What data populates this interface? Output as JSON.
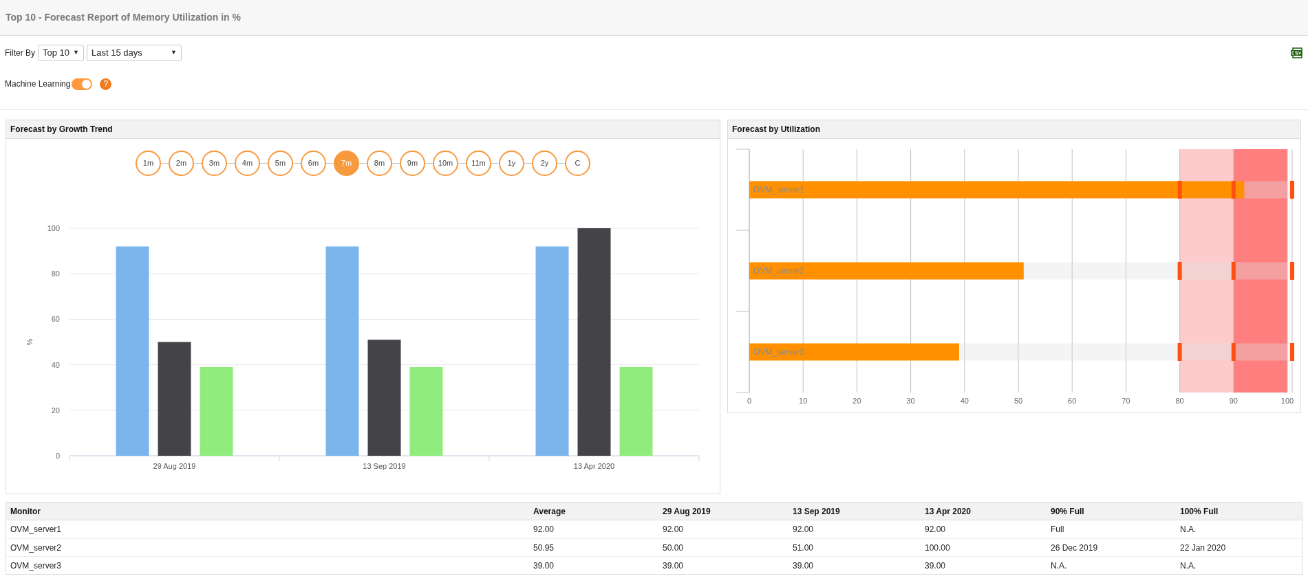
{
  "title": "Top 10 - Forecast Report of Memory Utilization in %",
  "filter": {
    "label": "Filter By",
    "selects": [
      {
        "value": "Top 10",
        "caret": "▼"
      },
      {
        "value": "Last 15 days",
        "caret": "▼"
      }
    ]
  },
  "machine_learning": {
    "label": "Machine Learning",
    "on": true,
    "help": "?"
  },
  "growth_panel": {
    "title": "Forecast by Growth Trend",
    "periods": [
      {
        "label": "1m",
        "selected": false
      },
      {
        "label": "2m",
        "selected": false
      },
      {
        "label": "3m",
        "selected": false
      },
      {
        "label": "4m",
        "selected": false
      },
      {
        "label": "5m",
        "selected": false
      },
      {
        "label": "6m",
        "selected": false
      },
      {
        "label": "7m",
        "selected": true
      },
      {
        "label": "8m",
        "selected": false
      },
      {
        "label": "9m",
        "selected": false
      },
      {
        "label": "10m",
        "selected": false
      },
      {
        "label": "11m",
        "selected": false
      },
      {
        "label": "1y",
        "selected": false
      },
      {
        "label": "2y",
        "selected": false
      },
      {
        "label": "C",
        "selected": false
      }
    ],
    "chart_data": {
      "type": "bar",
      "ylabel": "%",
      "categories": [
        "29 Aug 2019",
        "13 Sep 2019",
        "13 Apr 2020"
      ],
      "series": [
        {
          "color": "#7cb5ec",
          "values": [
            92,
            92,
            92
          ]
        },
        {
          "color": "#434348",
          "values": [
            50,
            51,
            100
          ]
        },
        {
          "color": "#90ed7d",
          "values": [
            39,
            39,
            39
          ]
        }
      ],
      "ylim": [
        0,
        100
      ],
      "yticks": [
        0,
        20,
        40,
        60,
        80,
        100
      ],
      "grid": true
    }
  },
  "utilization_panel": {
    "title": "Forecast by Utilization",
    "chart_data": {
      "type": "bar",
      "orientation": "horizontal",
      "categories": [
        "OVM_server1",
        "OVM_server2",
        "OVM_server3"
      ],
      "series": [
        {
          "color": "#ff9100",
          "values": [
            92,
            51,
            39
          ]
        }
      ],
      "xlim": [
        0,
        100
      ],
      "xticks": [
        0,
        10,
        20,
        30,
        40,
        50,
        60,
        70,
        80,
        90,
        100
      ],
      "grid": true,
      "bands": [
        {
          "axis": "x",
          "from": 80,
          "to": 90,
          "color": "#fdcbcb"
        },
        {
          "axis": "x",
          "from": 90,
          "to": 100,
          "color": "#ff7f7f"
        }
      ]
    }
  },
  "table": {
    "columns": [
      "Monitor",
      "Average",
      "29 Aug 2019",
      "13 Sep 2019",
      "13 Apr 2020",
      "90% Full",
      "100% Full"
    ],
    "rows": [
      [
        "OVM_server1",
        "92.00",
        "92.00",
        "92.00",
        "92.00",
        "Full",
        "N.A."
      ],
      [
        "OVM_server2",
        "50.95",
        "50.00",
        "51.00",
        "100.00",
        "26 Dec 2019",
        "22 Jan 2020"
      ],
      [
        "OVM_server3",
        "39.00",
        "39.00",
        "39.00",
        "39.00",
        "N.A.",
        "N.A."
      ]
    ]
  }
}
